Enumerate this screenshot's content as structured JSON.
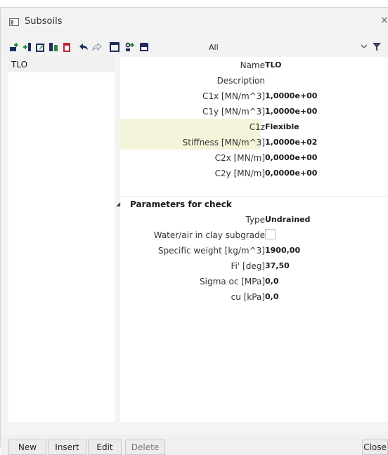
{
  "window": {
    "title": "Subsoils",
    "close_glyph": "×"
  },
  "toolbar": {
    "icons": [
      "new-row-icon",
      "insert-row-icon",
      "edit-icon",
      "copy-icon",
      "delete-icon",
      "undo-icon",
      "redo-icon",
      "table-icon",
      "structure-icon",
      "save-icon"
    ],
    "filter_value": "All"
  },
  "list": {
    "items": [
      {
        "label": "TLO"
      }
    ]
  },
  "properties": {
    "name": {
      "label": "Name",
      "value": "TLO"
    },
    "description": {
      "label": "Description",
      "value": ""
    },
    "c1x": {
      "label": "C1x [MN/m^3]",
      "value": "1,0000e+00"
    },
    "c1y": {
      "label": "C1y [MN/m^3]",
      "value": "1,0000e+00"
    },
    "c1z": {
      "label": "C1z",
      "value": "Flexible"
    },
    "stiffness": {
      "label": "Stiffness [MN/m^3]",
      "value": "1,0000e+02"
    },
    "c2x": {
      "label": "C2x [MN/m]",
      "value": "0,0000e+00"
    },
    "c2y": {
      "label": "C2y [MN/m]",
      "value": "0,0000e+00"
    },
    "section_title": "Parameters for check",
    "type": {
      "label": "Type",
      "value": "Undrained"
    },
    "water_air": {
      "label": "Water/air in clay subgrade",
      "checked": false
    },
    "specific_weight": {
      "label": "Specific weight [kg/m^3]",
      "value": "1900,00"
    },
    "fi": {
      "label": "Fi' [deg]",
      "value": "37,50"
    },
    "sigma_oc": {
      "label": "Sigma oc [MPa]",
      "value": "0,0"
    },
    "cu": {
      "label": "cu [kPa]",
      "value": "0,0"
    }
  },
  "buttons": {
    "new": "New",
    "insert": "Insert",
    "edit": "Edit",
    "delete": "Delete",
    "close": "Close"
  },
  "colors": {
    "highlight": "#f4f4da",
    "accent_red": "#c0263a",
    "accent_green": "#2e8b3e",
    "accent_navy": "#1f2d5a"
  }
}
